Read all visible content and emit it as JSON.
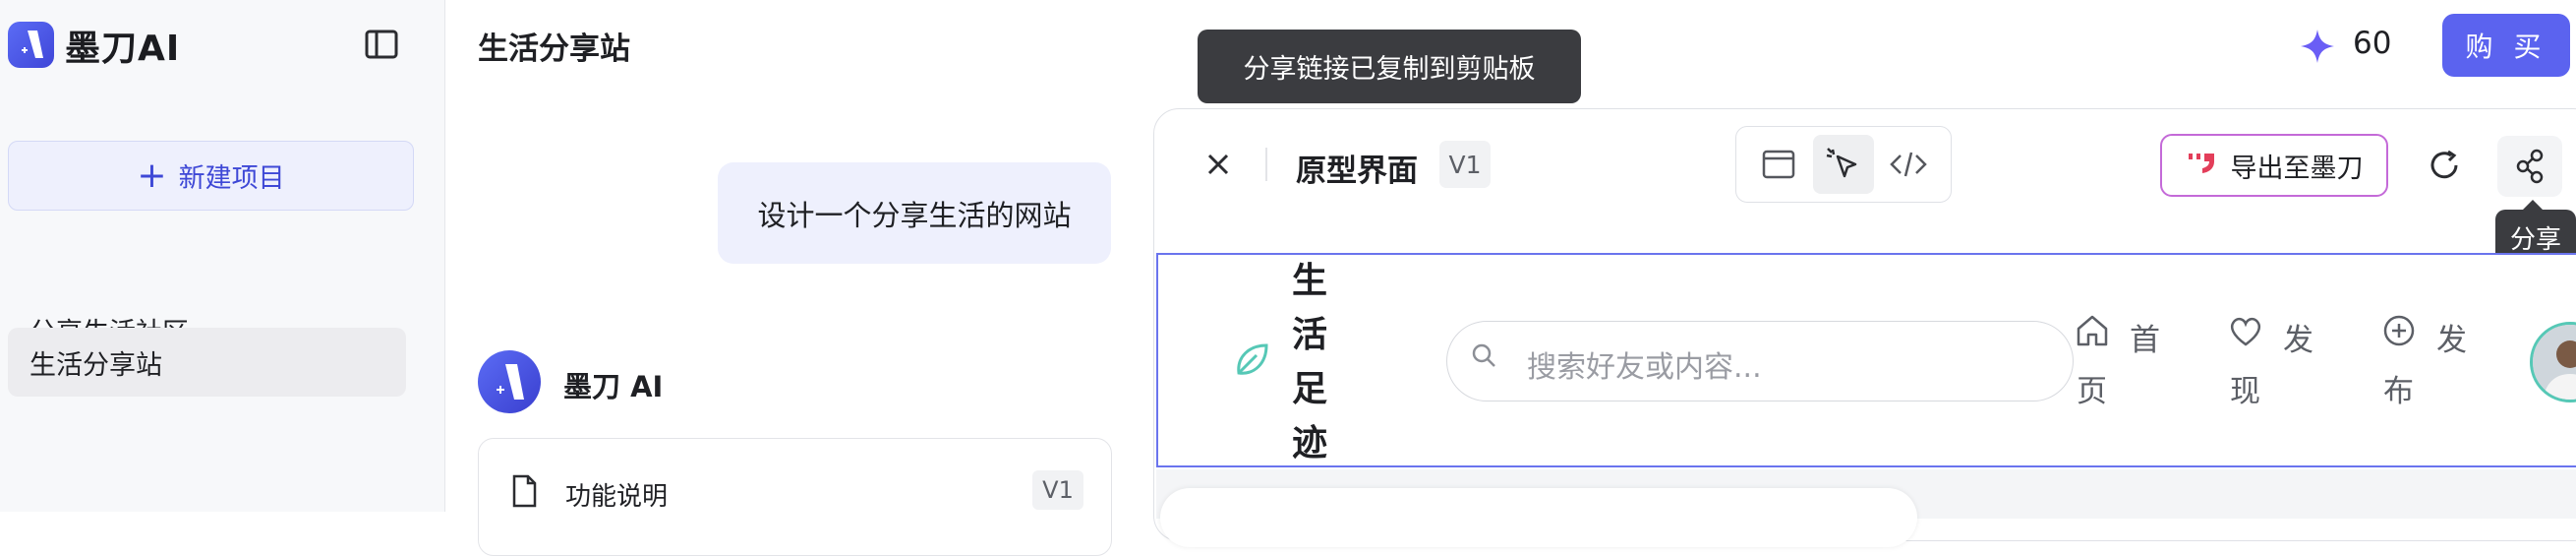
{
  "app": {
    "name": "墨刀AI",
    "brand_color": "#4a55e6"
  },
  "sidebar": {
    "new_project_label": "新建项目",
    "items": [
      {
        "label": "分享生活社区",
        "active": false
      },
      {
        "label": "生活分享站",
        "active": true
      }
    ]
  },
  "header": {
    "title": "生活分享站",
    "credits": "60",
    "buy_label": "购 买",
    "toast": "分享链接已复制到剪贴板"
  },
  "chat": {
    "user_message": "设计一个分享生活的网站",
    "assistant_name": "墨刀 AI",
    "card": {
      "label": "功能说明",
      "version": "V1"
    }
  },
  "preview": {
    "title": "原型界面",
    "version": "V1",
    "modes": [
      "preview-icon",
      "select-icon",
      "code-icon"
    ],
    "active_mode": "select-icon",
    "export_label": "导出至墨刀",
    "share_tooltip": "分享"
  },
  "prototype": {
    "brand": "生活足迹",
    "brand_color": "#56c8b6",
    "search_placeholder": "搜索好友或内容...",
    "nav": [
      {
        "label": "首页",
        "icon": "home-icon"
      },
      {
        "label": "发现",
        "icon": "heart-icon"
      },
      {
        "label": "发布",
        "icon": "plus-circle-icon"
      }
    ]
  }
}
